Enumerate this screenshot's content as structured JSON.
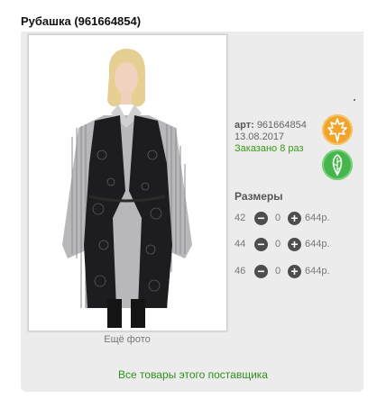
{
  "product": {
    "title": "Рубашка (961664854)",
    "art_label": "арт:",
    "art_value": "961664854",
    "date": "13.08.2017",
    "ordered": "Заказано 8 раз",
    "more_photos": "Ещё фото",
    "sizes_title": "Размеры",
    "sizes": [
      {
        "size": "42",
        "qty": "0",
        "price": "644р."
      },
      {
        "size": "44",
        "qty": "0",
        "price": "644р."
      },
      {
        "size": "46",
        "qty": "0",
        "price": "644р."
      }
    ],
    "supplier_link": "Все товары этого поставщика"
  },
  "icons": {
    "minus": "−",
    "plus": "+",
    "badge_orange": "maple-leaf-icon",
    "badge_green": "leaf-icon"
  },
  "colors": {
    "accent_green": "#2e8f1c",
    "badge_orange": "#f2a42a",
    "badge_green": "#46b64c"
  }
}
